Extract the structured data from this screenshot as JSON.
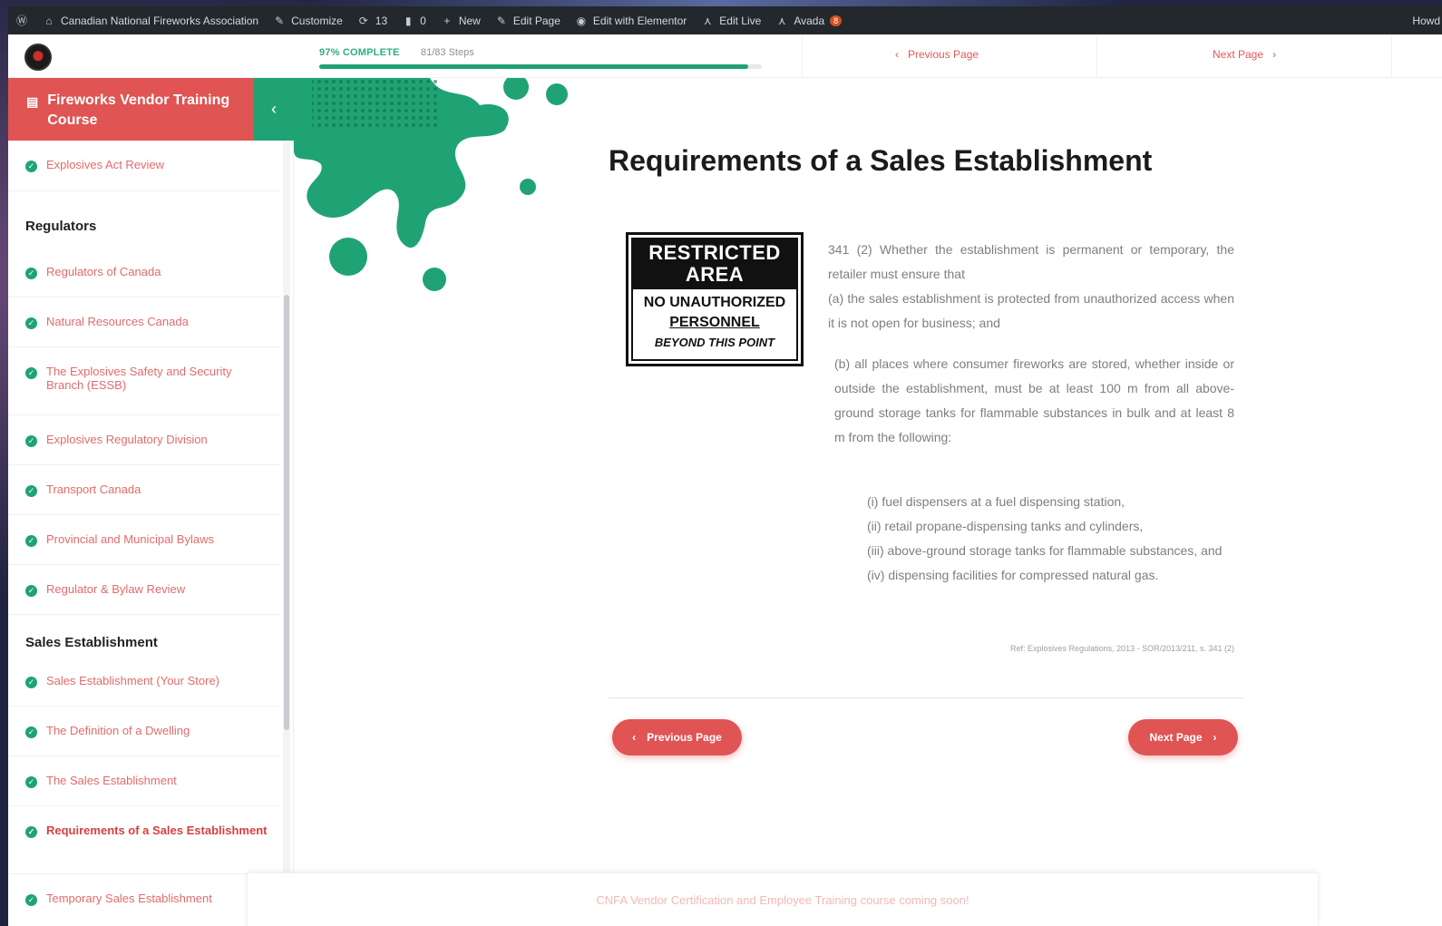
{
  "adminbar": {
    "site_name": "Canadian National Fireworks Association",
    "customize": "Customize",
    "updates_count": "13",
    "comments_count": "0",
    "new": "New",
    "edit_page": "Edit Page",
    "edit_elementor": "Edit with Elementor",
    "edit_live": "Edit Live",
    "avada": "Avada",
    "avada_badge": "8",
    "right_text": "Howd"
  },
  "course_top": {
    "progress_label": "97% COMPLETE",
    "progress_steps": "81/83 Steps",
    "progress_value": 0.97,
    "prev_label": "Previous Page",
    "next_label": "Next Page"
  },
  "sidebar": {
    "course_title": "Fireworks Vendor Training Course",
    "items": [
      {
        "type": "item",
        "label": "Explosives Act Review"
      },
      {
        "type": "section",
        "label": "Regulators"
      },
      {
        "type": "item",
        "label": "Regulators of Canada"
      },
      {
        "type": "item",
        "label": "Natural Resources Canada"
      },
      {
        "type": "item",
        "label": "The Explosives Safety and Security Branch (ESSB)"
      },
      {
        "type": "item",
        "label": "Explosives Regulatory Division"
      },
      {
        "type": "item",
        "label": "Transport Canada"
      },
      {
        "type": "item",
        "label": "Provincial and Municipal Bylaws"
      },
      {
        "type": "item",
        "label": "Regulator & Bylaw Review"
      },
      {
        "type": "section",
        "label": "Sales Establishment"
      },
      {
        "type": "item",
        "label": "Sales Establishment (Your Store)"
      },
      {
        "type": "item",
        "label": "The Definition of a Dwelling"
      },
      {
        "type": "item",
        "label": "The Sales Establishment"
      },
      {
        "type": "item",
        "label": "Requirements of a Sales Establishment",
        "current": true
      },
      {
        "type": "item",
        "label": "Temporary Sales Establishment"
      }
    ]
  },
  "main": {
    "title": "Requirements of a Sales Establishment",
    "sign": {
      "line1": "RESTRICTED",
      "line2": "AREA",
      "line3": "NO UNAUTHORIZED",
      "line4": "PERSONNEL",
      "line5": "BEYOND THIS POINT"
    },
    "para1": "341 (2) Whether the establishment is permanent or temporary, the retailer must ensure that",
    "para1b": "(a) the sales establishment is protected from unauthorized access when it is not open for business; and",
    "para2": "(b) all places where consumer fireworks are stored, whether inside or outside the establishment, must be at least 100 m from all above-ground storage tanks for flammable substances in bulk and at least 8 m from the following:",
    "list": [
      "(i) fuel dispensers at a fuel dispensing station,",
      "(ii) retail propane-dispensing tanks and cylinders,",
      "(iii) above-ground storage tanks for flammable substances, and",
      "(iv) dispensing facilities for compressed natural gas."
    ],
    "reference": "Ref: Explosives Regulations, 2013 - SOR/2013/211, s. 341 (2)",
    "prev_button": "Previous Page",
    "next_button": "Next Page"
  },
  "footer": {
    "text": "CNFA Vendor Certification and Employee Training course coming soon!"
  },
  "colors": {
    "accent_red": "#e05454",
    "accent_green": "#20a374",
    "adminbar": "#23282d"
  }
}
